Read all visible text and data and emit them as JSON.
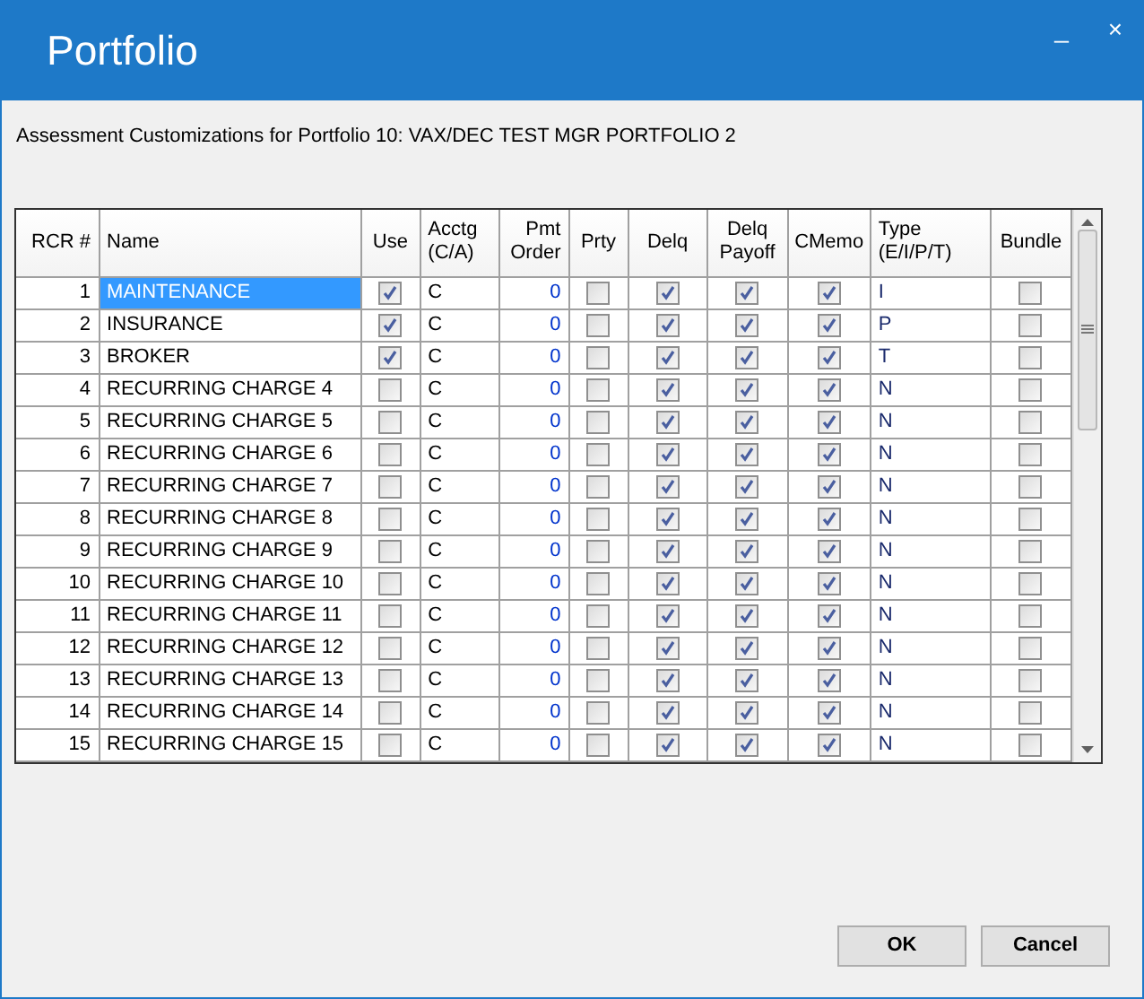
{
  "window": {
    "title": "Portfolio",
    "controls": [
      "_",
      "×"
    ]
  },
  "subtitle": "Assessment Customizations for Portfolio 10: VAX/DEC TEST MGR PORTFOLIO 2",
  "table": {
    "columns": [
      "RCR #",
      "Name",
      "Use",
      "Acctg (C/A)",
      "Pmt Order",
      "Prty",
      "Delq",
      "Delq Payoff",
      "CMemo",
      "Type (E/I/P/T)",
      "Bundle"
    ],
    "rows": [
      {
        "rcr": "1",
        "name": "MAINTENANCE",
        "selected": true,
        "use": true,
        "acctg": "C",
        "pmt_order": "0",
        "prty": false,
        "delq": true,
        "delq_payoff": true,
        "cmemo": true,
        "type": "I",
        "bundle": false
      },
      {
        "rcr": "2",
        "name": "INSURANCE",
        "selected": false,
        "use": true,
        "acctg": "C",
        "pmt_order": "0",
        "prty": false,
        "delq": true,
        "delq_payoff": true,
        "cmemo": true,
        "type": "P",
        "bundle": false
      },
      {
        "rcr": "3",
        "name": "BROKER",
        "selected": false,
        "use": true,
        "acctg": "C",
        "pmt_order": "0",
        "prty": false,
        "delq": true,
        "delq_payoff": true,
        "cmemo": true,
        "type": "T",
        "bundle": false
      },
      {
        "rcr": "4",
        "name": "RECURRING CHARGE 4",
        "selected": false,
        "use": false,
        "acctg": "C",
        "pmt_order": "0",
        "prty": false,
        "delq": true,
        "delq_payoff": true,
        "cmemo": true,
        "type": "N",
        "bundle": false
      },
      {
        "rcr": "5",
        "name": "RECURRING CHARGE 5",
        "selected": false,
        "use": false,
        "acctg": "C",
        "pmt_order": "0",
        "prty": false,
        "delq": true,
        "delq_payoff": true,
        "cmemo": true,
        "type": "N",
        "bundle": false
      },
      {
        "rcr": "6",
        "name": "RECURRING CHARGE 6",
        "selected": false,
        "use": false,
        "acctg": "C",
        "pmt_order": "0",
        "prty": false,
        "delq": true,
        "delq_payoff": true,
        "cmemo": true,
        "type": "N",
        "bundle": false
      },
      {
        "rcr": "7",
        "name": "RECURRING CHARGE 7",
        "selected": false,
        "use": false,
        "acctg": "C",
        "pmt_order": "0",
        "prty": false,
        "delq": true,
        "delq_payoff": true,
        "cmemo": true,
        "type": "N",
        "bundle": false
      },
      {
        "rcr": "8",
        "name": "RECURRING CHARGE 8",
        "selected": false,
        "use": false,
        "acctg": "C",
        "pmt_order": "0",
        "prty": false,
        "delq": true,
        "delq_payoff": true,
        "cmemo": true,
        "type": "N",
        "bundle": false
      },
      {
        "rcr": "9",
        "name": "RECURRING CHARGE 9",
        "selected": false,
        "use": false,
        "acctg": "C",
        "pmt_order": "0",
        "prty": false,
        "delq": true,
        "delq_payoff": true,
        "cmemo": true,
        "type": "N",
        "bundle": false
      },
      {
        "rcr": "10",
        "name": "RECURRING CHARGE 10",
        "selected": false,
        "use": false,
        "acctg": "C",
        "pmt_order": "0",
        "prty": false,
        "delq": true,
        "delq_payoff": true,
        "cmemo": true,
        "type": "N",
        "bundle": false
      },
      {
        "rcr": "11",
        "name": "RECURRING CHARGE 11",
        "selected": false,
        "use": false,
        "acctg": "C",
        "pmt_order": "0",
        "prty": false,
        "delq": true,
        "delq_payoff": true,
        "cmemo": true,
        "type": "N",
        "bundle": false
      },
      {
        "rcr": "12",
        "name": "RECURRING CHARGE 12",
        "selected": false,
        "use": false,
        "acctg": "C",
        "pmt_order": "0",
        "prty": false,
        "delq": true,
        "delq_payoff": true,
        "cmemo": true,
        "type": "N",
        "bundle": false
      },
      {
        "rcr": "13",
        "name": "RECURRING CHARGE 13",
        "selected": false,
        "use": false,
        "acctg": "C",
        "pmt_order": "0",
        "prty": false,
        "delq": true,
        "delq_payoff": true,
        "cmemo": true,
        "type": "N",
        "bundle": false
      },
      {
        "rcr": "14",
        "name": "RECURRING CHARGE 14",
        "selected": false,
        "use": false,
        "acctg": "C",
        "pmt_order": "0",
        "prty": false,
        "delq": true,
        "delq_payoff": true,
        "cmemo": true,
        "type": "N",
        "bundle": false
      },
      {
        "rcr": "15",
        "name": "RECURRING CHARGE 15",
        "selected": false,
        "use": false,
        "acctg": "C",
        "pmt_order": "0",
        "prty": false,
        "delq": true,
        "delq_payoff": true,
        "cmemo": true,
        "type": "N",
        "bundle": false
      }
    ]
  },
  "buttons": [
    "OK",
    "Cancel"
  ]
}
